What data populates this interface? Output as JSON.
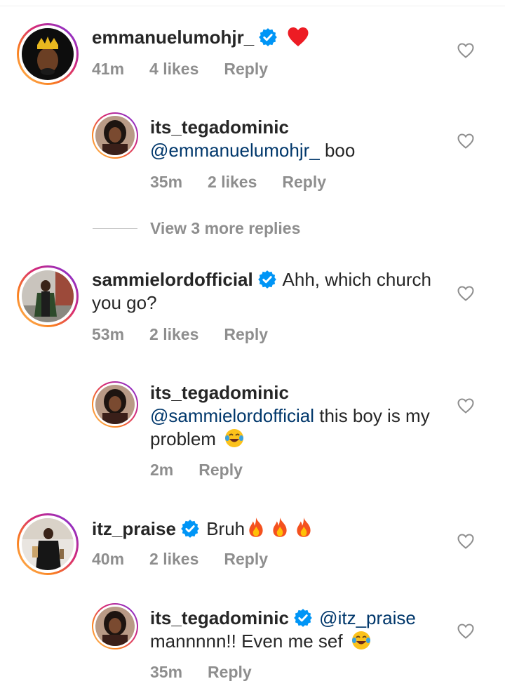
{
  "comments": [
    {
      "username": "emmanuelumohjr_",
      "verified": true,
      "text": "",
      "time": "41m",
      "likes": "4 likes",
      "reply_label": "Reply"
    },
    {
      "username": "its_tegadominic",
      "verified": false,
      "mention": "@emmanuelumohjr_",
      "text": "boo",
      "time": "35m",
      "likes": "2 likes",
      "reply_label": "Reply"
    },
    {
      "username": "sammielordofficial",
      "verified": true,
      "text": "Ahh, which church you go?",
      "time": "53m",
      "likes": "2 likes",
      "reply_label": "Reply"
    },
    {
      "username": "its_tegadominic",
      "verified": false,
      "mention": "@sammielordofficial",
      "text": "this boy is my problem",
      "time": "2m",
      "reply_label": "Reply"
    },
    {
      "username": "itz_praise",
      "verified": true,
      "text": "Bruh",
      "time": "40m",
      "likes": "2 likes",
      "reply_label": "Reply"
    },
    {
      "username": "its_tegadominic",
      "verified": true,
      "mention": "@itz_praise",
      "text": "mannnnn!! Even me sef",
      "time": "35m",
      "reply_label": "Reply"
    }
  ],
  "view_more_replies": "View 3 more replies",
  "colors": {
    "verified": "#0095f6",
    "meta": "#8e8e8e",
    "mention": "#00376b",
    "heart_emoji": "#ed1c24"
  },
  "icons": {
    "like": "heart-outline-icon",
    "verified": "verified-badge-icon"
  }
}
